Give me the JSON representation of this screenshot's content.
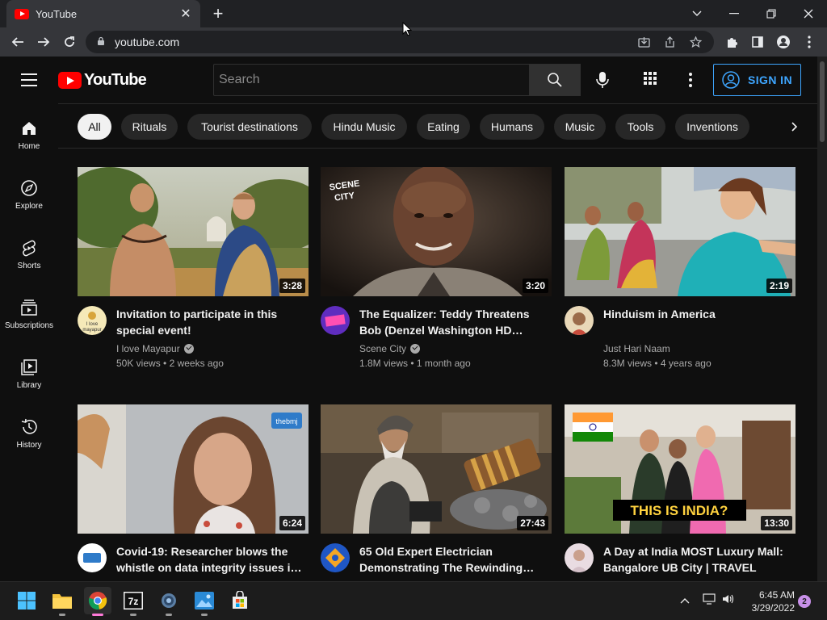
{
  "browser": {
    "tab_title": "YouTube",
    "url": "youtube.com"
  },
  "header": {
    "search_placeholder": "Search",
    "sign_in": "SIGN IN"
  },
  "sidebar": {
    "items": [
      {
        "label": "Home",
        "icon": "home-icon"
      },
      {
        "label": "Explore",
        "icon": "compass-icon"
      },
      {
        "label": "Shorts",
        "icon": "shorts-icon"
      },
      {
        "label": "Subscriptions",
        "icon": "subscriptions-icon"
      },
      {
        "label": "Library",
        "icon": "library-icon"
      },
      {
        "label": "History",
        "icon": "history-icon"
      }
    ]
  },
  "chips": [
    "All",
    "Rituals",
    "Tourist destinations",
    "Hindu Music",
    "Eating",
    "Humans",
    "Music",
    "Tools",
    "Inventions"
  ],
  "videos": [
    {
      "title": "Invitation to participate in this special event!",
      "channel": "I love Mayapur",
      "verified": true,
      "views": "50K views",
      "age": "2 weeks ago",
      "duration": "3:28"
    },
    {
      "title": "The Equalizer: Teddy Threatens Bob (Denzel Washington HD…",
      "channel": "Scene City",
      "verified": true,
      "views": "1.8M views",
      "age": "1 month ago",
      "duration": "3:20"
    },
    {
      "title": "Hinduism in America",
      "channel": "Just Hari Naam",
      "verified": false,
      "views": "8.3M views",
      "age": "4 years ago",
      "duration": "2:19"
    },
    {
      "title": "Covid-19: Researcher blows the whistle on data integrity issues i…",
      "channel": "",
      "verified": false,
      "views": "",
      "age": "",
      "duration": "6:24"
    },
    {
      "title": "65 Old Expert Electrician Demonstrating The Rewinding…",
      "channel": "",
      "verified": false,
      "views": "",
      "age": "",
      "duration": "27:43"
    },
    {
      "title": "A Day at India MOST Luxury Mall: Bangalore UB City | TRAVEL VLO…",
      "channel": "",
      "verified": false,
      "views": "",
      "age": "",
      "duration": "13:30"
    }
  ],
  "thumb_text": {
    "scene_city_1": "SCENE",
    "scene_city_2": "CITY",
    "thebmj": "thebmj",
    "india": "THIS IS INDIA?",
    "avatar_mayapur_1": "I love",
    "avatar_mayapur_2": "mayapur"
  },
  "taskbar": {
    "time": "6:45 AM",
    "date": "3/29/2022",
    "notifications": "2",
    "seven_zip": "7z"
  },
  "colors": {
    "youtube_red": "#ff0000",
    "signin_blue": "#3ea6ff",
    "background": "#0f0f0f"
  }
}
